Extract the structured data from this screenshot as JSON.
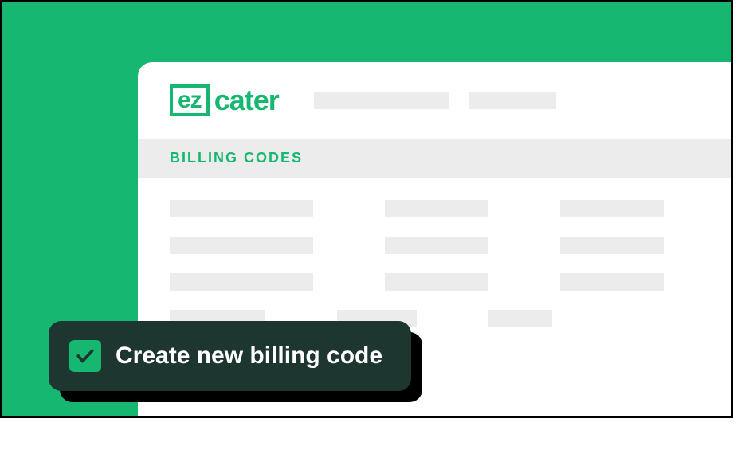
{
  "logo": {
    "boxed": "ez",
    "rest": "cater"
  },
  "section": {
    "title": "BILLING CODES"
  },
  "action": {
    "create_label": "Create new billing code"
  }
}
